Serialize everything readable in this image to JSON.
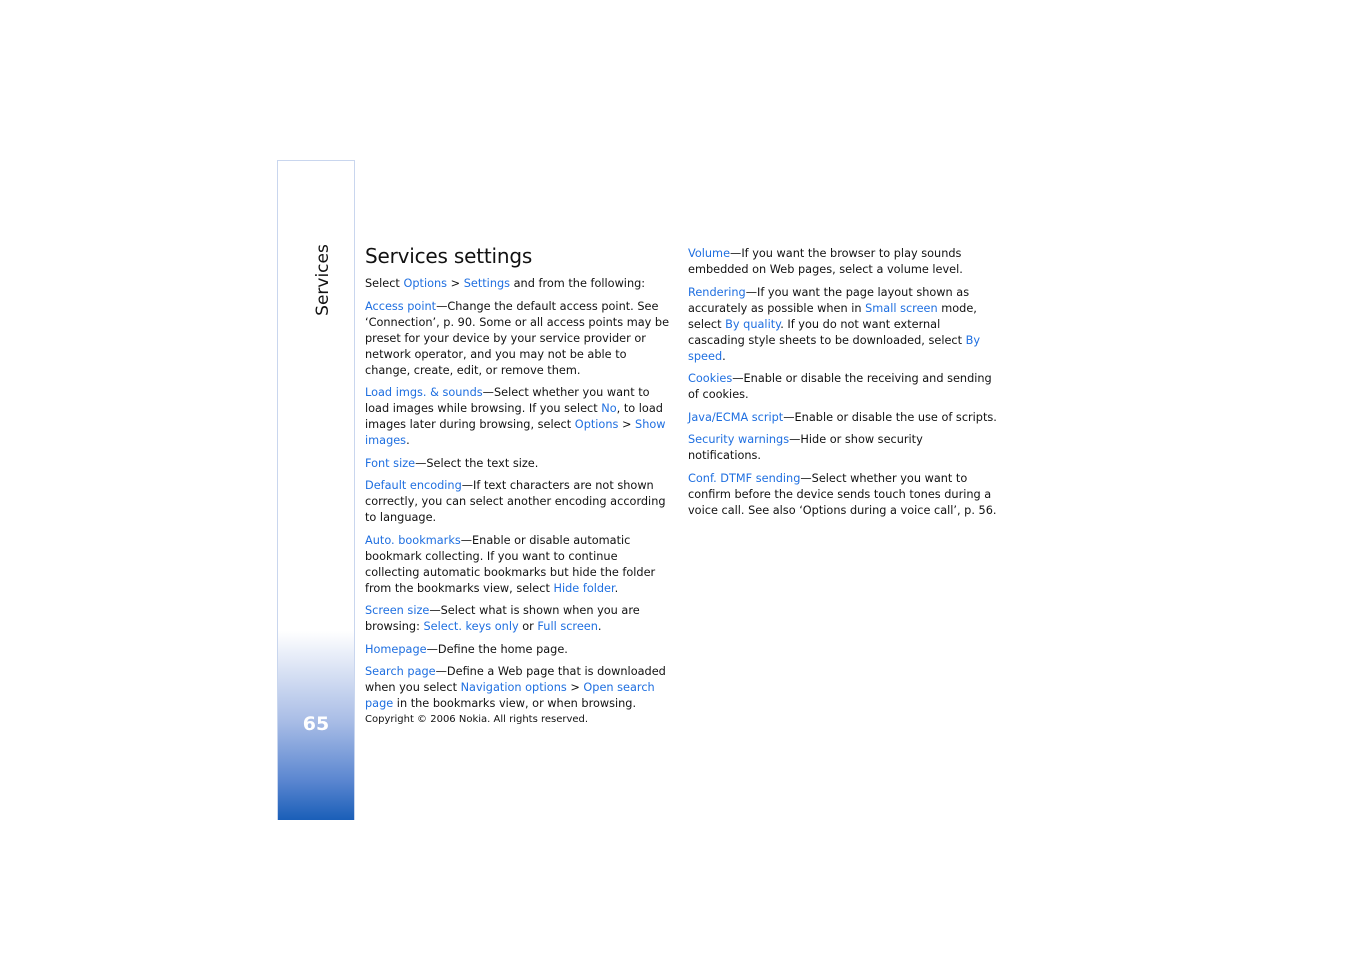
{
  "sidebar": {
    "section": "Services",
    "page_number": "65"
  },
  "title": "Services settings",
  "colors": {
    "link": "#1f6fe0",
    "sidebar_gradient_end": "#1a5fb8"
  },
  "left": [
    [
      {
        "t": "Select "
      },
      {
        "t": "Options",
        "l": 1
      },
      {
        "t": " > "
      },
      {
        "t": "Settings",
        "l": 1
      },
      {
        "t": " and from the following:"
      }
    ],
    [
      {
        "t": "Access point",
        "l": 1
      },
      {
        "t": "—Change the default access point. See ‘Connection’, p. 90. Some or all access points may be preset for your device by your service provider or network operator, and you may not be able to change, create, edit, or remove them."
      }
    ],
    [
      {
        "t": "Load imgs. & sounds",
        "l": 1
      },
      {
        "t": "—Select whether you want to load images while browsing. If you select "
      },
      {
        "t": "No",
        "l": 1
      },
      {
        "t": ", to load images later during browsing, select "
      },
      {
        "t": "Options",
        "l": 1
      },
      {
        "t": " > "
      },
      {
        "t": "Show images",
        "l": 1
      },
      {
        "t": "."
      }
    ],
    [
      {
        "t": "Font size",
        "l": 1
      },
      {
        "t": "—Select the text size."
      }
    ],
    [
      {
        "t": "Default encoding",
        "l": 1
      },
      {
        "t": "—If text characters are not shown correctly, you can select another encoding according to language."
      }
    ],
    [
      {
        "t": "Auto. bookmarks",
        "l": 1
      },
      {
        "t": "—Enable or disable automatic bookmark collecting. If you want to continue collecting automatic bookmarks but hide the folder from the bookmarks view, select "
      },
      {
        "t": "Hide folder",
        "l": 1
      },
      {
        "t": "."
      }
    ],
    [
      {
        "t": "Screen size",
        "l": 1
      },
      {
        "t": "—Select what is shown when you are browsing: "
      },
      {
        "t": "Select. keys only",
        "l": 1
      },
      {
        "t": " or "
      },
      {
        "t": "Full screen",
        "l": 1
      },
      {
        "t": "."
      }
    ],
    [
      {
        "t": "Homepage",
        "l": 1
      },
      {
        "t": "—Define the home page."
      }
    ],
    [
      {
        "t": "Search page",
        "l": 1
      },
      {
        "t": "—Define a Web page that is downloaded when you select "
      },
      {
        "t": "Navigation options",
        "l": 1
      },
      {
        "t": " > "
      },
      {
        "t": "Open search page",
        "l": 1
      },
      {
        "t": " in the bookmarks view, or when browsing."
      }
    ]
  ],
  "right": [
    [
      {
        "t": "Volume",
        "l": 1
      },
      {
        "t": "—If you want the browser to play sounds embedded on Web pages, select a volume level."
      }
    ],
    [
      {
        "t": "Rendering",
        "l": 1
      },
      {
        "t": "—If you want the page layout shown as accurately as possible when in "
      },
      {
        "t": "Small screen",
        "l": 1
      },
      {
        "t": " mode, select "
      },
      {
        "t": "By quality",
        "l": 1
      },
      {
        "t": ". If you do not want external cascading style sheets to be downloaded, select "
      },
      {
        "t": "By speed",
        "l": 1
      },
      {
        "t": "."
      }
    ],
    [
      {
        "t": "Cookies",
        "l": 1
      },
      {
        "t": "—Enable or disable the receiving and sending of cookies."
      }
    ],
    [
      {
        "t": "Java/ECMA script",
        "l": 1
      },
      {
        "t": "—Enable or disable the use of scripts."
      }
    ],
    [
      {
        "t": "Security warnings",
        "l": 1
      },
      {
        "t": "—Hide or show security notifications."
      }
    ],
    [
      {
        "t": "Conf. DTMF sending",
        "l": 1
      },
      {
        "t": "—Select whether you want to confirm before the device sends touch tones during a voice call. See also ‘Options during a voice call’, p. 56."
      }
    ]
  ],
  "footer": "Copyright © 2006 Nokia. All rights reserved."
}
